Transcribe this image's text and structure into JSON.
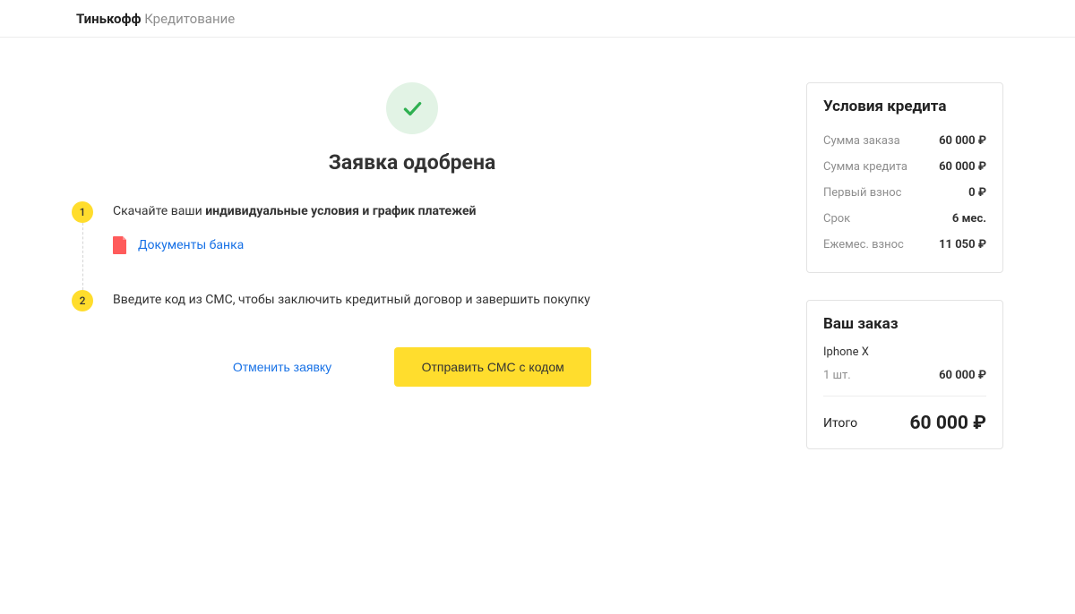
{
  "brand": {
    "bold": "Тинькофф",
    "rest": " Кредитование"
  },
  "main": {
    "title": "Заявка одобрена",
    "step1": {
      "num": "1",
      "text_prefix": "Скачайте ваши ",
      "text_bold": "индивидуальные условия и график платежей",
      "doc_link": "Документы банка"
    },
    "step2": {
      "num": "2",
      "text": "Введите код из СМС, чтобы заключить кредитный договор и завершить покупку"
    },
    "cancel_label": "Отменить заявку",
    "send_sms_label": "Отправить СМС с кодом"
  },
  "credit": {
    "title": "Условия кредита",
    "rows": [
      {
        "label": "Сумма заказа",
        "value": "60 000 ₽"
      },
      {
        "label": "Сумма кредита",
        "value": "60 000 ₽"
      },
      {
        "label": "Первый взнос",
        "value": "0 ₽"
      },
      {
        "label": "Срок",
        "value": "6 мес."
      },
      {
        "label": "Ежемес. взнос",
        "value": "11 050 ₽"
      }
    ]
  },
  "order": {
    "title": "Ваш заказ",
    "product": "Iphone X",
    "qty_label": "1 шт.",
    "qty_value": "60 000 ₽",
    "total_label": "Итого",
    "total_value": "60 000 ₽"
  }
}
